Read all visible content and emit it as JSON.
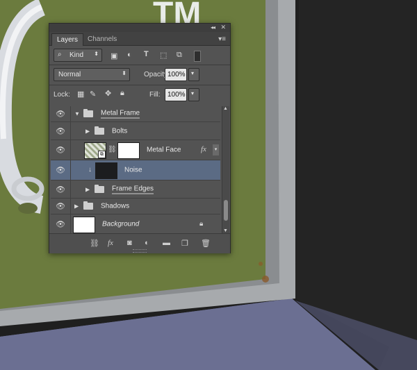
{
  "canvas": {
    "trademark": "TM",
    "colors": {
      "board_green": "#6b7b3e",
      "frame_metal": "#a9acaf",
      "backing_noise": "#1f1f1f",
      "desk": "#6b6f92"
    }
  },
  "panel": {
    "tabs": [
      {
        "label": "Layers",
        "active": true
      },
      {
        "label": "Channels",
        "active": false
      }
    ],
    "filter": {
      "label": "Kind"
    },
    "blend_mode": "Normal",
    "opacity": {
      "label": "Opacity:",
      "value": "100%"
    },
    "lock": {
      "label": "Lock:"
    },
    "fill": {
      "label": "Fill:",
      "value": "100%"
    },
    "layers": [
      {
        "name": "Metal Frame",
        "type": "group",
        "expanded": true,
        "indent": 0,
        "selected": false
      },
      {
        "name": "Bolts",
        "type": "group",
        "expanded": false,
        "indent": 1,
        "selected": false
      },
      {
        "name": "Metal Face",
        "type": "layer",
        "indent": 1,
        "selected": false,
        "has_fx": true,
        "fx": "fx"
      },
      {
        "name": "Noise",
        "type": "layer",
        "indent": 1,
        "selected": true,
        "clipped": true
      },
      {
        "name": "Frame Edges",
        "type": "group",
        "expanded": false,
        "indent": 1,
        "selected": false
      },
      {
        "name": "Shadows",
        "type": "group",
        "expanded": false,
        "indent": 0,
        "selected": false
      },
      {
        "name": "Background",
        "type": "layer",
        "indent": 0,
        "selected": false,
        "locked": true
      }
    ],
    "footer_icons": [
      "link-icon",
      "fx-icon",
      "mask-icon",
      "adjustment-icon",
      "folder-icon",
      "new-layer-icon",
      "trash-icon"
    ]
  }
}
